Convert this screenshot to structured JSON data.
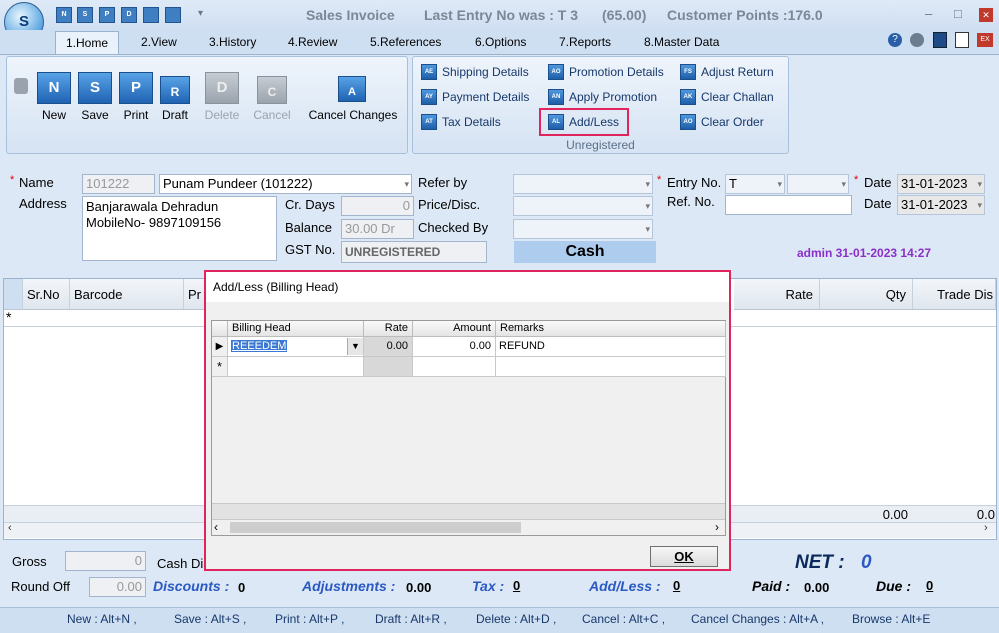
{
  "app": {
    "title": "Sales Invoice",
    "last_entry": "Last Entry No was : T 3",
    "last_entry_amount": "(65.00)",
    "customer_points": "Customer Points :176.0",
    "logo_letter": "S",
    "minimize": "–",
    "maximize": "□",
    "close": "✕",
    "qat": [
      "N",
      "S",
      "P",
      "D",
      "",
      "",
      ""
    ],
    "dropdown_arrow": "▾"
  },
  "tabs": [
    "1.Home",
    "2.View",
    "3.History",
    "4.Review",
    "5.References",
    "6.Options",
    "7.Reports",
    "8.Master Data"
  ],
  "ribbon": {
    "actions": [
      {
        "label": "New",
        "icon": "N",
        "enabled": true
      },
      {
        "label": "Save",
        "icon": "S",
        "enabled": true
      },
      {
        "label": "Print",
        "icon": "P",
        "enabled": true
      },
      {
        "label": "Draft",
        "icon": "R",
        "enabled": true
      },
      {
        "label": "Delete",
        "icon": "D",
        "enabled": false
      },
      {
        "label": "Cancel",
        "icon": "C",
        "enabled": false
      },
      {
        "label": "Cancel Changes",
        "icon": "A",
        "enabled": true
      }
    ],
    "col1": [
      "Shipping Details",
      "Payment Details",
      "Tax Details"
    ],
    "col2": [
      "Promotion Details",
      "Apply Promotion",
      "Add/Less"
    ],
    "col3": [
      "Adjust Return",
      "Clear Challan",
      "Clear Order"
    ],
    "group_label": "Unregistered"
  },
  "form": {
    "name_label": "Name",
    "name_code": "101222",
    "name_value": "Punam Pundeer (101222)",
    "address_label": "Address",
    "address_line1": "Banjarawala Dehradun",
    "address_line2": "MobileNo- 9897109156",
    "cr_days_label": "Cr. Days",
    "cr_days_value": "0",
    "balance_label": "Balance",
    "balance_value": "30.00 Dr",
    "gst_label": "GST No.",
    "gst_value": "UNREGISTERED",
    "refer_by_label": "Refer by",
    "price_disc_label": "Price/Disc.",
    "checked_by_label": "Checked By",
    "payment_mode": "Cash",
    "entry_no_label": "Entry No.",
    "entry_no_value": "T",
    "ref_no_label": "Ref. No.",
    "date_label": "Date",
    "date_value": "31-01-2023",
    "date2_label": "Date",
    "date2_value": "31-01-2023",
    "user_stamp": "admin 31-01-2023 14:27"
  },
  "grid": {
    "columns": [
      "Sr.No",
      "Barcode",
      "Pr",
      "Rate",
      "Qty",
      "Trade Dis"
    ],
    "new_row_marker": "*",
    "footer_qty": "0.00",
    "footer_trade": "0.0"
  },
  "dialog": {
    "title": "Add/Less (Billing Head)",
    "columns": [
      "Billing Head",
      "Rate",
      "Amount",
      "Remarks"
    ],
    "row": {
      "billing_head": "REEEDEM",
      "rate": "0.00",
      "amount": "0.00",
      "remarks": "REFUND"
    },
    "new_row_marker": "*",
    "ok": "OK"
  },
  "totals": {
    "gross_label": "Gross",
    "gross_value": "0",
    "cash_dis_label": "Cash Di",
    "round_off_label": "Round Off",
    "round_off_value": "0.00",
    "discounts_label": "Discounts :",
    "discounts_value": "0",
    "adjustments_label": "Adjustments :",
    "adjustments_value": "0.00",
    "tax_label": "Tax :",
    "tax_value": "0",
    "addless_label": "Add/Less :",
    "addless_value": "0",
    "net_label": "NET :",
    "net_value": "0",
    "paid_label": "Paid :",
    "paid_value": "0.00",
    "due_label": "Due :",
    "due_value": "0"
  },
  "shortcuts": [
    "New : Alt+N ,",
    "Save : Alt+S ,",
    "Print : Alt+P ,",
    "Draft : Alt+R ,",
    "Delete : Alt+D ,",
    "Cancel : Alt+C ,",
    "Cancel Changes : Alt+A ,",
    "Browse : Alt+E"
  ],
  "colors": {
    "accent": "#2b59c3",
    "highlight": "#e0245e",
    "user_stamp": "#8b2fc9"
  }
}
